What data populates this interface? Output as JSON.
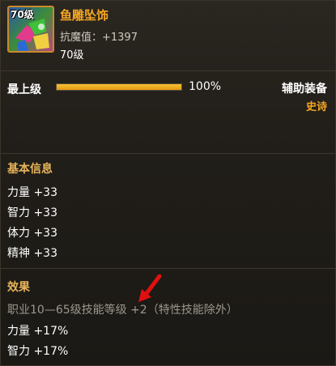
{
  "item": {
    "level_tag": "70级",
    "name": "鱼雕坠饰",
    "resist": "抗魔值：+1397",
    "level": "70级"
  },
  "max_level": {
    "label": "最上级",
    "progress": 1.0,
    "percent_text": "100%"
  },
  "equip": {
    "slot": "辅助装备",
    "rarity": "史诗"
  },
  "basic_info": {
    "title": "基本信息",
    "stats": [
      "力量 +33",
      "智力 +33",
      "体力 +33",
      "精神 +33"
    ]
  },
  "effects": {
    "title": "效果",
    "lines": [
      "职业10—65级技能等级 +2（特性技能除外）",
      "力量 +17%",
      "智力 +17%"
    ]
  },
  "colors": {
    "name": "#f5a623",
    "rarity": "#f5a623",
    "section": "#e8b45a",
    "bar": "#f7c234",
    "arrow": "#e01010"
  },
  "icons": [
    "pendant-item-icon",
    "red-arrow-icon"
  ]
}
